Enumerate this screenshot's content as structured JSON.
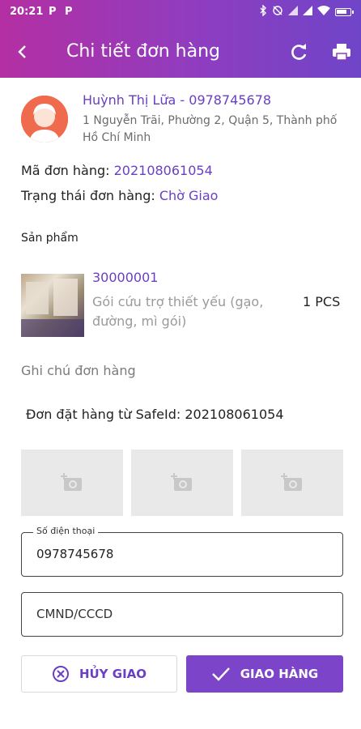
{
  "status_bar": {
    "time": "20:21",
    "app_icon_1": "P",
    "app_icon_2": "P",
    "icons": [
      "bluetooth-icon",
      "mute-icon",
      "signal-icon",
      "signal-icon",
      "wifi-icon",
      "battery-icon"
    ]
  },
  "app_bar": {
    "title": "Chi tiết đơn hàng",
    "back_icon": "back-arrow-icon",
    "refresh_icon": "refresh-icon",
    "print_icon": "print-icon",
    "colors": {
      "gradient_start": "#b42fa3",
      "gradient_end": "#6f45c8"
    }
  },
  "customer": {
    "name_phone": "Huỳnh Thị Lữa - 0978745678",
    "address": "1 Nguyễn Trãi, Phường 2, Quận 5, Thành phố Hồ Chí Minh"
  },
  "order": {
    "code_label": "Mã đơn hàng: ",
    "code": "202108061054",
    "status_label": "Trạng thái đơn hàng: ",
    "status": "Chờ Giao"
  },
  "products": {
    "section_label": "Sản phẩm",
    "items": [
      {
        "code": "30000001",
        "name": "Gói cứu trợ thiết yếu (gạo, đường, mì gói)",
        "quantity": "1 PCS"
      }
    ]
  },
  "note": {
    "placeholder": "Ghi chú đơn hàng"
  },
  "order_source": "Đơn đặt hàng từ SafeId: 202108061054",
  "photos": {
    "slots": 3,
    "icon": "add-photo-icon"
  },
  "phone_field": {
    "label": "Số điện thoại",
    "value": "0978745678"
  },
  "id_field": {
    "placeholder": "CMND/CCCD"
  },
  "actions": {
    "cancel_label": "HỦY GIAO",
    "deliver_label": "GIAO HÀNG"
  },
  "accent_color": "#6a3fc2"
}
